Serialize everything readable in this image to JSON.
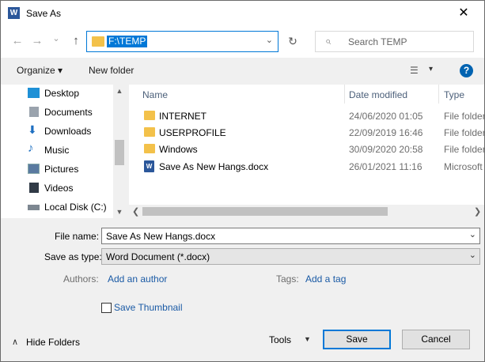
{
  "window": {
    "app_icon": "W",
    "title": "Save As",
    "close_glyph": "✕"
  },
  "nav": {
    "back_glyph": "←",
    "forward_glyph": "→",
    "recent_glyph": "⌄",
    "up_glyph": "↑",
    "address": "F:\\TEMP",
    "address_chevron": "⌄",
    "refresh_glyph": "↻",
    "search_glyph": "⌕",
    "search_placeholder": "Search TEMP"
  },
  "toolbar": {
    "organize_label": "Organize ▾",
    "new_folder_label": "New folder",
    "view_glyph": "☰",
    "view_chevron": "▾",
    "help_glyph": "?"
  },
  "sidebar": {
    "scroll_up": "▲",
    "scroll_down": "▼",
    "items": [
      {
        "label": "Desktop",
        "icon": "desktop-icon",
        "color": "#1e90d6"
      },
      {
        "label": "Documents",
        "icon": "documents-icon",
        "color": "#9aa3ad"
      },
      {
        "label": "Downloads",
        "icon": "downloads-icon",
        "color": "#1e6fc1"
      },
      {
        "label": "Music",
        "icon": "music-icon",
        "color": "#1e6fc1"
      },
      {
        "label": "Pictures",
        "icon": "pictures-icon",
        "color": "#5a7aa0"
      },
      {
        "label": "Videos",
        "icon": "videos-icon",
        "color": "#303a46"
      },
      {
        "label": "Local Disk (C:)",
        "icon": "local-disk-icon",
        "color": "#7d8791"
      }
    ]
  },
  "files": {
    "columns": {
      "name": "Name",
      "date": "Date modified",
      "type": "Type"
    },
    "sort_glyph": "⌃",
    "rows": [
      {
        "name": "INTERNET",
        "date": "24/06/2020 01:05",
        "type": "File folder",
        "kind": "folder"
      },
      {
        "name": "USERPROFILE",
        "date": "22/09/2019 16:46",
        "type": "File folder",
        "kind": "folder"
      },
      {
        "name": "Windows",
        "date": "30/09/2020 20:58",
        "type": "File folder",
        "kind": "folder"
      },
      {
        "name": "Save As New Hangs.docx",
        "date": "26/01/2021 11:16",
        "type": "Microsoft",
        "kind": "docx"
      }
    ],
    "scroll_left": "❮",
    "scroll_right": "❯"
  },
  "form": {
    "file_name_label": "File name:",
    "file_name_value": "Save As New Hangs.docx",
    "save_type_label": "Save as type:",
    "save_type_value": "Word Document (*.docx)",
    "combo_chevron": "⌄",
    "authors_label": "Authors:",
    "authors_link": "Add an author",
    "tags_label": "Tags:",
    "tags_link": "Add a tag",
    "thumbnail_label": "Save Thumbnail"
  },
  "footer": {
    "hide_folders_caret": "∧",
    "hide_folders_label": "Hide Folders",
    "tools_label": "Tools",
    "tools_chevron": "▼",
    "save_label": "Save",
    "cancel_label": "Cancel"
  }
}
